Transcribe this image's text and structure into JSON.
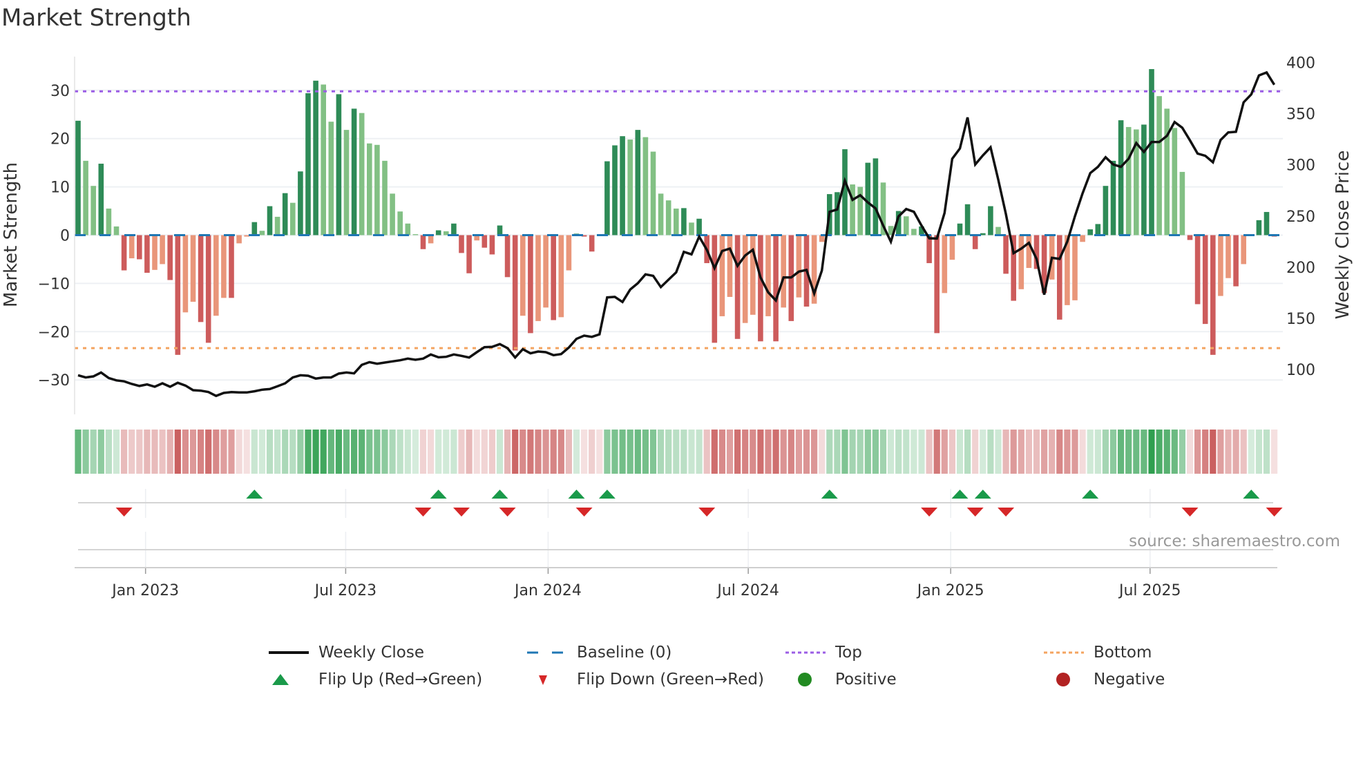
{
  "chart_data": {
    "type": "bar",
    "title": "Market Strength",
    "ylabel": "Market Strength",
    "y2label": "Weekly Close Price",
    "ylim": [
      -37,
      37
    ],
    "y2lim": [
      56,
      406
    ],
    "yticks": [
      -30,
      -20,
      -10,
      0,
      10,
      20,
      30
    ],
    "yticklabels": [
      "−30",
      "−20",
      "−10",
      "0",
      "10",
      "20",
      "30"
    ],
    "y2ticks": [
      100,
      150,
      200,
      250,
      300,
      350,
      400
    ],
    "y2ticklabels": [
      "100",
      "150",
      "200",
      "250",
      "300",
      "350",
      "400"
    ],
    "x_ticks": [
      {
        "label": "Jan 2023",
        "week": 9.8
      },
      {
        "label": "Jul 2023",
        "week": 35.9
      },
      {
        "label": "Jan 2024",
        "week": 62.3
      },
      {
        "label": "Jul 2024",
        "week": 88.4
      },
      {
        "label": "Jan 2025",
        "week": 114.8
      },
      {
        "label": "Jul 2025",
        "week": 140.8
      }
    ],
    "top_line": 29.8,
    "bottom_line": -23.4,
    "baseline": 0,
    "grid": true,
    "legend_position": "bottom",
    "strength": [
      23.7,
      15.4,
      10.2,
      14.8,
      5.5,
      1.8,
      -7.3,
      -4.8,
      -5.0,
      -7.8,
      -7.2,
      -6.0,
      -9.3,
      -24.8,
      -16,
      -13.8,
      -18,
      -22.3,
      -16.7,
      -13,
      -13,
      -1.7,
      -0.3,
      2.7,
      0.9,
      6,
      3.8,
      8.7,
      6.7,
      13.2,
      29.4,
      32,
      31.2,
      23.5,
      29.2,
      21.8,
      26.2,
      25.3,
      19,
      18.7,
      15.4,
      8.6,
      4.9,
      2.4,
      0.2,
      -2.9,
      -1.7,
      1.0,
      0.8,
      2.4,
      -3.7,
      -7.9,
      -1.1,
      -2.6,
      -4.0,
      2.0,
      -8.7,
      -23.9,
      -16.7,
      -20.3,
      -17.8,
      -15,
      -17.6,
      -17,
      -7.3,
      0.3,
      -0.3,
      -3.4,
      -0.2,
      15.3,
      18.6,
      20.5,
      19.8,
      21.8,
      20.3,
      17.3,
      8.6,
      7.2,
      5.5,
      5.6,
      2.6,
      3.4,
      -5.8,
      -22.3,
      -16.8,
      -12.8,
      -21.5,
      -18.2,
      -16.5,
      -22,
      -16.8,
      -22,
      -15,
      -17.8,
      -12.9,
      -14.8,
      -14.2,
      -1.4,
      8.5,
      8.9,
      17.8,
      10.5,
      10,
      15,
      15.9,
      10.9,
      1.9,
      5,
      3.9,
      1.3,
      1.8,
      -5.8,
      -20.3,
      -12,
      -5.1,
      2.4,
      6.4,
      -2.9,
      0.4,
      6,
      1.7,
      -8,
      -13.6,
      -11.2,
      -6.8,
      -7,
      -12,
      -9.2,
      -17.5,
      -14.5,
      -13.5,
      -1.4,
      1.2,
      2.3,
      10.2,
      15.4,
      23.8,
      22.4,
      21.9,
      22.9,
      34.4,
      28.8,
      26.2,
      22.2,
      13.1,
      -1,
      -14.3,
      -18.4,
      -24.8,
      -12.6,
      -8.9,
      -10.6,
      -6,
      0.2,
      3.1,
      4.8,
      -0.3
    ],
    "close": [
      94.5,
      92.3,
      93.4,
      97.2,
      91.8,
      89.5,
      88.5,
      86,
      84,
      85.5,
      83.3,
      86.6,
      83.3,
      87.1,
      84.4,
      79.9,
      79.4,
      78.1,
      74.3,
      77.2,
      78.1,
      77.7,
      77.7,
      78.8,
      80.4,
      81,
      83.7,
      86.6,
      92.3,
      94.5,
      94,
      91.2,
      92.3,
      92.3,
      96.1,
      97.2,
      96.3,
      104.6,
      107.3,
      105.7,
      106.9,
      108,
      109.1,
      110.7,
      109.6,
      110.7,
      114.8,
      112,
      112.5,
      114.8,
      113.4,
      111.8,
      117,
      121.9,
      122.2,
      124.9,
      121,
      111.8,
      119.9,
      115.9,
      117.7,
      117,
      114.1,
      115.2,
      121.5,
      130,
      133.2,
      132,
      134.5,
      170.5,
      171,
      166,
      178.2,
      184.4,
      193,
      191.6,
      180.6,
      187.8,
      195,
      215,
      212.6,
      229.9,
      217,
      199.1,
      215.9,
      218.2,
      201.3,
      211.4,
      217,
      190,
      175.5,
      167.6,
      190,
      190,
      195.7,
      197.3,
      174.3,
      196.8,
      254.1,
      256.4,
      284.5,
      265.8,
      270.3,
      263.2,
      257.5,
      240.6,
      224.9,
      249.7,
      256.8,
      254.1,
      240.6,
      228.3,
      228,
      253,
      305.9,
      316,
      346.3,
      300.3,
      309.2,
      317.1,
      285.6,
      251.9,
      213.7,
      218.2,
      223.8,
      208.1,
      173.2,
      209.2,
      208.1,
      224.9,
      249.7,
      272.1,
      291.9,
      298,
      307.4,
      300.3,
      298,
      305.9,
      321.2,
      312.6,
      322.3,
      322.3,
      328.3,
      341.8,
      336.2,
      323.9,
      311,
      308.8,
      302.5,
      324.3,
      331.7,
      332.2,
      361,
      368.8,
      387.3,
      390.2,
      378.2
    ],
    "colors": {
      "pos_rising": "#2e8b57",
      "pos_falling": "#82c084",
      "neg_falling": "#cd5c5c",
      "neg_rising": "#e9967a",
      "heat_pos": "#2e9e4e",
      "heat_neg": "#c85a5a",
      "line": "#111111",
      "baseline": "#1f77b4",
      "top": "#9b5de5",
      "bottom": "#f4a460",
      "flip_up": "#1a9a4a",
      "flip_down": "#d62728",
      "positive": "#228b22",
      "negative": "#b22222"
    }
  },
  "source": "source: sharemaestro.com",
  "legend": {
    "weekly_close": "Weekly Close",
    "baseline": "Baseline (0)",
    "top": "Top",
    "bottom": "Bottom",
    "flip_up": "Flip Up (Red→Green)",
    "flip_down": "Flip Down (Green→Red)",
    "positive": "Positive",
    "negative": "Negative"
  }
}
